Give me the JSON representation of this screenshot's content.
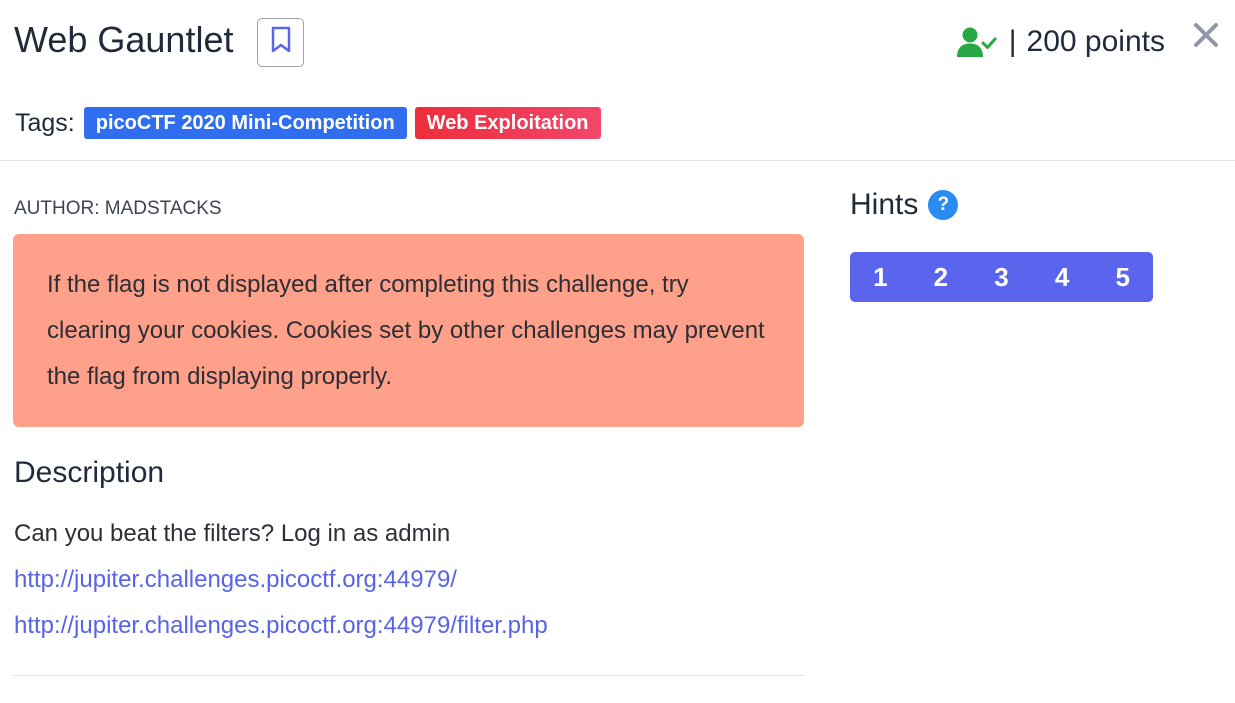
{
  "challenge": {
    "title": "Web Gauntlet",
    "points": "200 points",
    "points_separator": "|"
  },
  "tags": {
    "label": "Tags:",
    "items": [
      {
        "label": "picoCTF 2020 Mini-Competition",
        "color": "#2f6fef"
      },
      {
        "label": "Web Exploitation",
        "color": "#ee2d3b"
      }
    ]
  },
  "author": "AUTHOR: MADSTACKS",
  "alert": {
    "text": "If the flag is not displayed after completing this challenge, try clearing your cookies. Cookies set by other challenges may prevent the flag from displaying properly.",
    "color": "#ffa08a"
  },
  "description": {
    "heading": "Description",
    "text": "Can you beat the filters? Log in as admin",
    "links": [
      "http://jupiter.challenges.picoctf.org:44979/",
      "http://jupiter.challenges.picoctf.org:44979/filter.php"
    ]
  },
  "hints": {
    "heading": "Hints",
    "help_glyph": "?",
    "items": [
      "1",
      "2",
      "3",
      "4",
      "5"
    ],
    "color": "#5b64ec"
  },
  "icons": {
    "bookmark": "bookmark-icon",
    "solved": "user-check-icon",
    "close": "close-icon",
    "help": "question-circle-icon"
  }
}
